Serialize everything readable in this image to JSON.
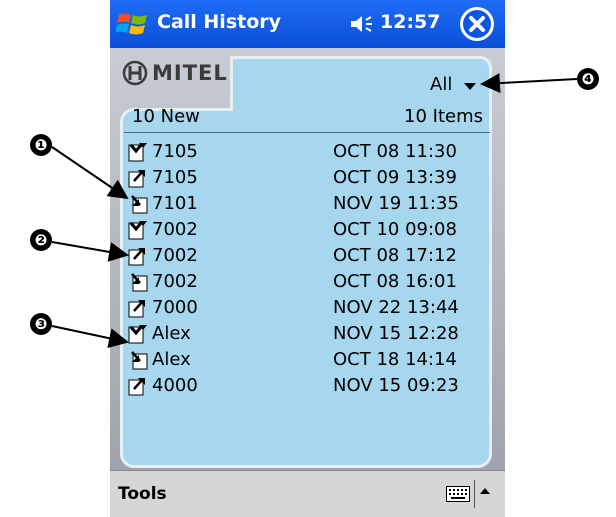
{
  "titlebar": {
    "title": "Call History",
    "time": "12:57"
  },
  "header": {
    "brand": "MITEL",
    "filter_value": "All",
    "new_count": "10 New",
    "item_count": "10 Items"
  },
  "calls": [
    {
      "name": "7105",
      "time": "OCT 08 11:30",
      "icon": "missed-call-icon"
    },
    {
      "name": "7105",
      "time": "OCT 09 13:39",
      "icon": "outgoing-call-icon"
    },
    {
      "name": "7101",
      "time": "NOV 19 11:35",
      "icon": "incoming-call-icon"
    },
    {
      "name": "7002",
      "time": "OCT 10 09:08",
      "icon": "missed-call-icon"
    },
    {
      "name": "7002",
      "time": "OCT 08 17:12",
      "icon": "outgoing-call-icon"
    },
    {
      "name": "7002",
      "time": "OCT 08 16:01",
      "icon": "incoming-call-icon"
    },
    {
      "name": "7000",
      "time": "NOV 22 13:44",
      "icon": "outgoing-call-icon"
    },
    {
      "name": "Alex",
      "time": "NOV 15 12:28",
      "icon": "missed-call-icon"
    },
    {
      "name": "Alex",
      "time": "OCT 18 14:14",
      "icon": "incoming-call-icon"
    },
    {
      "name": "4000",
      "time": "NOV 15 09:23",
      "icon": "outgoing-call-icon"
    }
  ],
  "menubar": {
    "tools_label": "Tools"
  },
  "callouts": [
    "❶",
    "❷",
    "❸",
    "❹"
  ],
  "colors": {
    "titlebar": "#0a57e6",
    "list_background": "#a6d7ee",
    "frame": "#b8bcc4",
    "menubar": "#d6d6d6"
  }
}
